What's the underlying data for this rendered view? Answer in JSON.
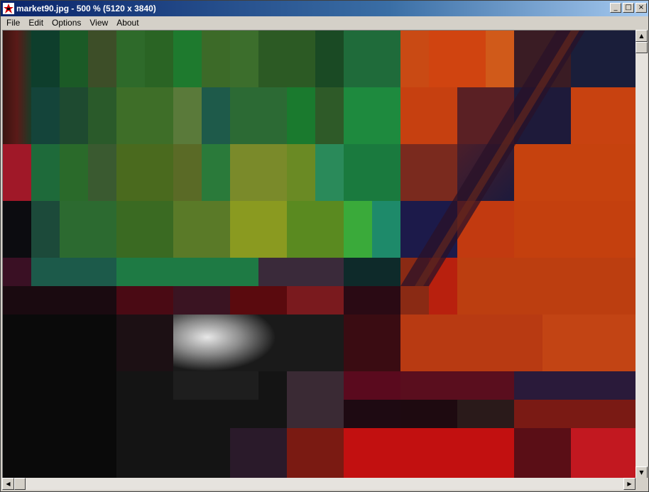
{
  "window": {
    "title": "market90.jpg - 500 % (5120 x 3840)",
    "app_icon": "irfanview-icon",
    "controls": {
      "minimize_icon": "minimize-icon",
      "maximize_icon": "maximize-icon",
      "close_icon": "close-icon"
    }
  },
  "menubar": {
    "items": [
      {
        "label": "File"
      },
      {
        "label": "Edit"
      },
      {
        "label": "Options"
      },
      {
        "label": "View"
      },
      {
        "label": "About"
      }
    ]
  },
  "image_view": {
    "description_icon": "zoomed-image-canvas",
    "zoom_percent": 500,
    "image_width": 5120,
    "image_height": 3840
  },
  "scrollbars": {
    "vertical": {
      "up_icon": "scroll-up-icon",
      "down_icon": "scroll-down-icon",
      "position": 0
    },
    "horizontal": {
      "left_icon": "scroll-left-icon",
      "right_icon": "scroll-right-icon",
      "position": 0
    }
  },
  "colors": {
    "titlebar_start": "#0a246a",
    "titlebar_end": "#a6caf0",
    "chrome": "#d4d0c8"
  }
}
